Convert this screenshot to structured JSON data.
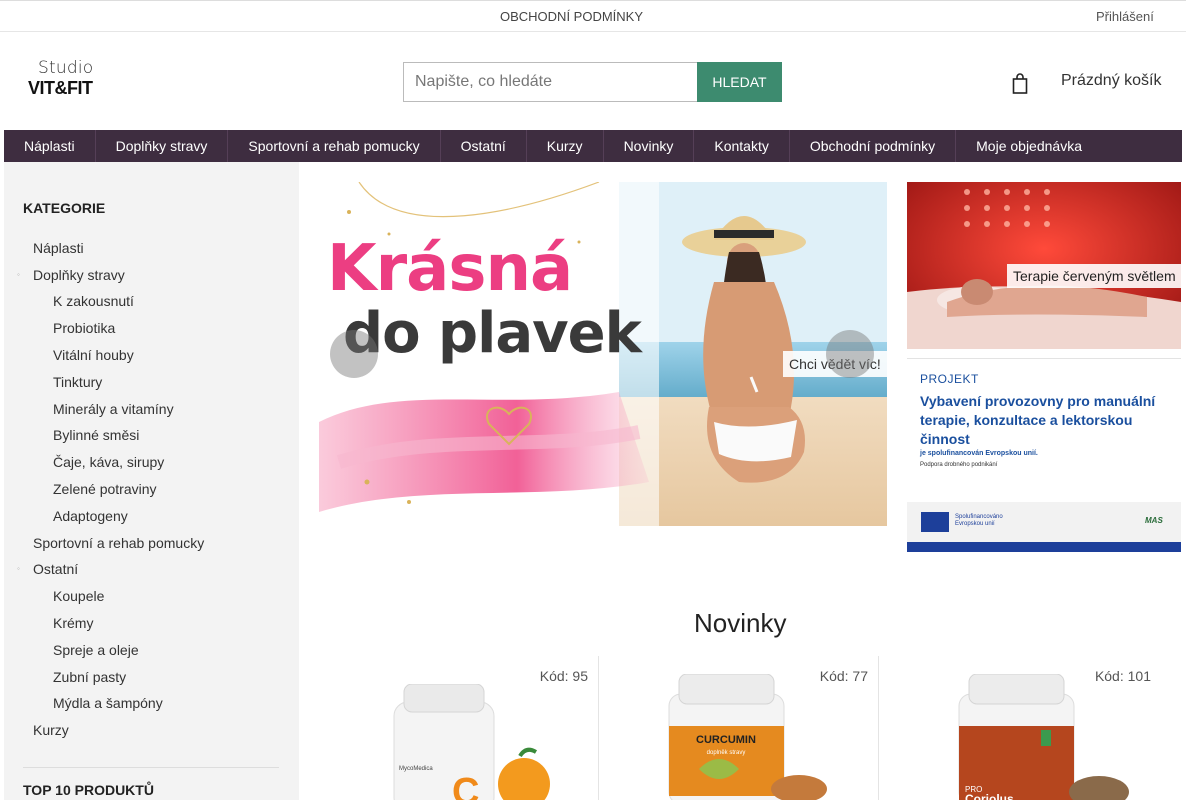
{
  "topbar": {
    "terms": "OBCHODNÍ PODMÍNKY",
    "icon_glyph": "",
    "login": "Přihlášení"
  },
  "header": {
    "logo_line1": "Studio",
    "logo_line2": "VIT&FIT",
    "search_placeholder": "Napište, co hledáte",
    "search_button": "HLEDAT",
    "cart_label": "Prázdný košík",
    "accent_color": "#3d8b6f",
    "nav_color": "#3e2d40"
  },
  "nav": [
    "Náplasti",
    "Doplňky stravy",
    "Sportovní a rehab pomucky",
    "Ostatní",
    "Kurzy",
    "Novinky",
    "Kontakty",
    "Obchodní podmínky",
    "Moje objednávka"
  ],
  "sidebar": {
    "title": "KATEGORIE",
    "categories": [
      "Náplasti",
      "Doplňky stravy",
      "K zakousnutí",
      "Probiotika",
      "Vitální houby",
      "Tinktury",
      "Minerály a vitamíny",
      "Bylinné směsi",
      "Čaje, káva, sirupy",
      "Zelené potraviny",
      "Adaptogeny",
      "Sportovní a rehab pomucky",
      "Ostatní",
      "Koupele",
      "Krémy",
      "Spreje a oleje",
      "Zubní pasty",
      "Mýdla a šampóny",
      "Kurzy"
    ],
    "top10_title": "TOP 10 PRODUKTŮ"
  },
  "hero": {
    "headline1": "Krásná",
    "headline2": "do plavek",
    "cta": "Chci vědět víc!",
    "prev_icon": "",
    "next_icon": ""
  },
  "promos": {
    "light_therapy": "Terapie červeným světlem",
    "project_label": "PROJEKT",
    "project_head": "Vybavení provozovny pro manuální terapie, konzultace a lektorskou činnost",
    "project_sub": "je spolufinancován Evropskou unií.",
    "project_sub2": "Podpora drobného podnikání",
    "eu_text": "Spolufinancováno Evropskou unií",
    "mas_logo": "MAS"
  },
  "novinky": {
    "title": "Novinky",
    "products": [
      {
        "code": "Kód: 95",
        "label": "MycoMedica",
        "letter": "C"
      },
      {
        "code": "Kód: 77",
        "label": "CURCUMIN",
        "sub": "doplněk stravy"
      },
      {
        "code": "Kód: 101",
        "label": "Coriolus",
        "pre": "PRO"
      }
    ]
  }
}
